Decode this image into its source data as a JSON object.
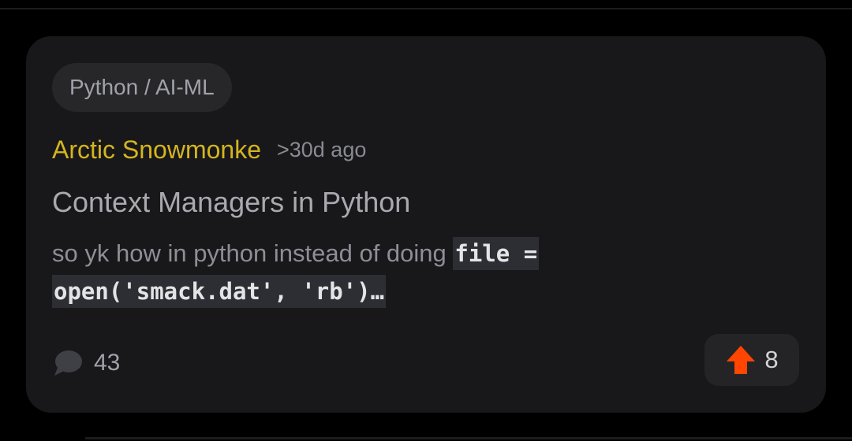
{
  "post": {
    "category": "Python / AI-ML",
    "author": "Arctic Snowmonke",
    "time": ">30d ago",
    "title": "Context Managers in Python",
    "excerpt_text": "so yk how in python instead of doing ",
    "excerpt_code_line1": "file =",
    "excerpt_code_line2": "open('smack.dat', 'rb')…",
    "comment_count": "43",
    "upvote_count": "8"
  },
  "icons": {
    "comment": "comment-bubble-icon",
    "upvote": "upvote-arrow-icon"
  },
  "colors": {
    "background": "#000000",
    "card": "#18181b",
    "author": "#d4b51f",
    "upvote": "#ff4500"
  }
}
